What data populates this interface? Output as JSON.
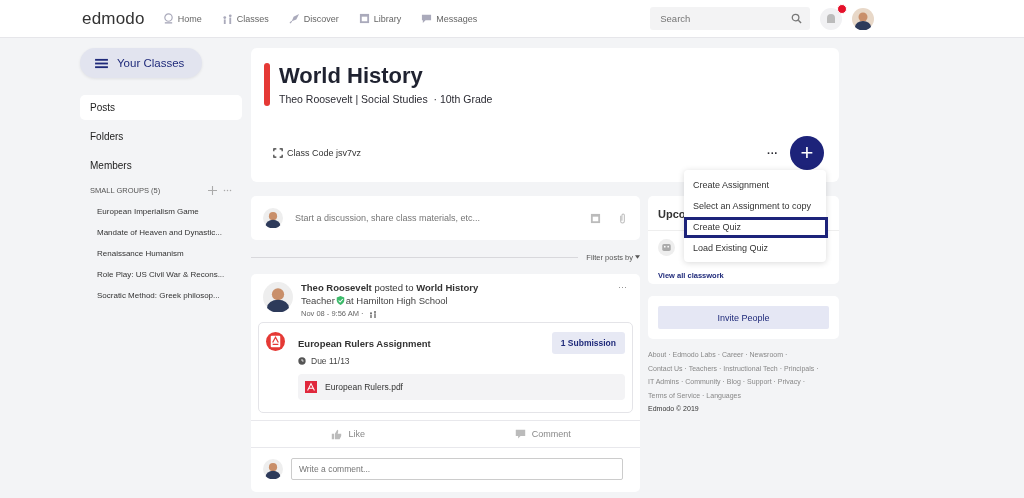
{
  "nav": {
    "logo": "edmodo",
    "items": [
      "Home",
      "Classes",
      "Discover",
      "Library",
      "Messages"
    ],
    "search": {
      "placeholder": "Search"
    },
    "notification_badge": true
  },
  "sidebar": {
    "classes_button": "Your Classes",
    "items": [
      {
        "label": "Posts",
        "selected": true
      },
      {
        "label": "Folders",
        "selected": false
      },
      {
        "label": "Members",
        "selected": false
      }
    ],
    "groups_heading": "SMALL GROUPS (5)",
    "groups": [
      "European Imperialism Game",
      "Mandate of Heaven and Dynastic...",
      "Renaissance Humanism",
      "Role Play: US Civil War & Recons...",
      "Socratic Method: Greek philosop..."
    ]
  },
  "class_header": {
    "title": "World History",
    "subtitle": "Theo Roosevelt | Social Studies  · 10th Grade",
    "class_code": "Class Code jsv7vz",
    "more": "···",
    "add": "+"
  },
  "menu": [
    {
      "label": "Create Assignment",
      "selected": false
    },
    {
      "label": "Select an Assignment to copy",
      "selected": false
    },
    {
      "label": "Create Quiz",
      "selected": true
    },
    {
      "label": "Load Existing Quiz",
      "selected": false
    }
  ],
  "composer": {
    "placeholder": "Start a discussion, share class materials, etc..."
  },
  "filter": "Filter posts by",
  "post": {
    "author": "Theo Roosevelt",
    "verb": "posted to",
    "target": "World History",
    "role": "Teacher",
    "school": "at Hamilton High School",
    "time": "Nov 08 - 9:56 AM ·",
    "more": "···",
    "assignment": {
      "title": "European Rulers Assignment",
      "submissions": "1 Submission",
      "due": "Due 11/13",
      "file": "European Rulers.pdf"
    },
    "actions": [
      "Like",
      "Comment"
    ],
    "comment_placeholder": "Write a comment..."
  },
  "upcoming": {
    "title": "Upco",
    "link": "View all classwork"
  },
  "invite": "Invite People",
  "footer": [
    "About · Edmodo Labs · Career · Newsroom ·",
    "Contact Us · Teachers · Instructional Tech · Principals ·",
    "IT Admins · Community · Blog · Support · Privacy ·",
    "Terms of Service  · Languages"
  ],
  "copyright": "Edmodo © 2019"
}
